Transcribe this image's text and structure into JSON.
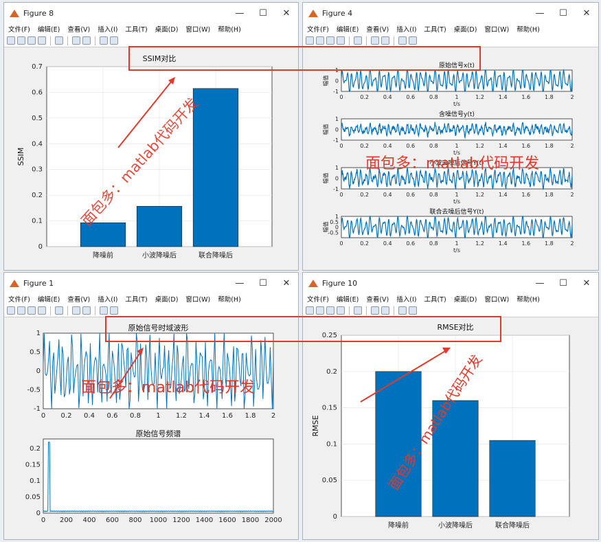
{
  "menu": [
    "文件(F)",
    "编辑(E)",
    "查看(V)",
    "插入(I)",
    "工具(T)",
    "桌面(D)",
    "窗口(W)",
    "帮助(H)"
  ],
  "watermark": "面包多：matlab代码开发",
  "fig8": {
    "title": "Figure 8",
    "chart_data": {
      "type": "bar",
      "title": "SSIM对比",
      "ylabel": "SSIM",
      "categories": [
        "降噪前",
        "小波降噪后",
        "联合降噪后"
      ],
      "values": [
        0.093,
        0.157,
        0.615
      ],
      "ylim": [
        0,
        0.7
      ],
      "yticks": [
        "0",
        "0.1",
        "0.2",
        "0.3",
        "0.4",
        "0.5",
        "0.6",
        "0.7"
      ],
      "color": "#0072bd"
    }
  },
  "fig4": {
    "title": "Figure 4",
    "chart_data": [
      {
        "type": "line",
        "title": "原始信号x(t)",
        "xlabel": "t/s",
        "ylabel": "幅值",
        "xlim": [
          0,
          2
        ],
        "ylim": [
          -1,
          1
        ],
        "yticks": [
          "1",
          "0",
          "-1"
        ],
        "xticks": [
          "0",
          "0.2",
          "0.4",
          "0.6",
          "0.8",
          "1",
          "1.2",
          "1.4",
          "1.6",
          "1.8",
          "2"
        ]
      },
      {
        "type": "line",
        "title": "含噪信号y(t)",
        "xlabel": "t/s",
        "ylabel": "幅值",
        "xlim": [
          0,
          2
        ],
        "ylim": [
          -1,
          1
        ],
        "yticks": [
          "1",
          "0",
          "-1"
        ],
        "xticks": [
          "0",
          "0.2",
          "0.4",
          "0.6",
          "0.8",
          "1",
          "1.2",
          "1.4",
          "1.6",
          "1.8",
          "2"
        ]
      },
      {
        "type": "line",
        "title": "小波去噪后信号Y(t)",
        "xlabel": "t/s",
        "ylabel": "幅值",
        "xlim": [
          0,
          2
        ],
        "ylim": [
          -1,
          1
        ],
        "yticks": [
          "1",
          "0",
          "-1"
        ],
        "xticks": [
          "0",
          "0.2",
          "0.4",
          "0.6",
          "0.8",
          "1",
          "1.2",
          "1.4",
          "1.6",
          "1.8",
          "2"
        ]
      },
      {
        "type": "line",
        "title": "联合去噪后信号Y(t)",
        "xlabel": "t/s",
        "ylabel": "幅值",
        "xlim": [
          0,
          2
        ],
        "ylim": [
          -1,
          1
        ],
        "yticks": [
          "1",
          "0.5",
          "0",
          "-0.5"
        ],
        "xticks": [
          "0",
          "0.2",
          "0.4",
          "0.6",
          "0.8",
          "1",
          "1.2",
          "1.4",
          "1.6",
          "1.8",
          "2"
        ]
      }
    ]
  },
  "fig1": {
    "title": "Figure 1",
    "chart_data": [
      {
        "type": "line",
        "title": "原始信号时域波形",
        "xlim": [
          0,
          2
        ],
        "ylim": [
          -1,
          1
        ],
        "yticks": [
          "1",
          "0.5",
          "0",
          "-0.5",
          "-1"
        ],
        "xticks": [
          "0",
          "0.2",
          "0.4",
          "0.6",
          "0.8",
          "1",
          "1.2",
          "1.4",
          "1.6",
          "1.8",
          "2"
        ]
      },
      {
        "type": "line",
        "title": "原始信号频谱",
        "xlim": [
          0,
          2000
        ],
        "ylim": [
          0,
          0.23
        ],
        "yticks": [
          "0.2",
          "0.15",
          "0.1",
          "0.05",
          "0"
        ],
        "xticks": [
          "0",
          "200",
          "400",
          "600",
          "800",
          "1000",
          "1200",
          "1400",
          "1600",
          "1800",
          "2000"
        ],
        "peak": {
          "x": [
            45,
            55
          ],
          "y": 0.22
        }
      }
    ]
  },
  "fig10": {
    "title": "Figure 10",
    "chart_data": {
      "type": "bar",
      "title": "RMSE对比",
      "ylabel": "RMSE",
      "categories": [
        "降噪前",
        "小波降噪后",
        "联合降噪后"
      ],
      "values": [
        0.2,
        0.16,
        0.105
      ],
      "ylim": [
        0,
        0.25
      ],
      "yticks": [
        "0",
        "0.05",
        "0.1",
        "0.15",
        "0.2",
        "0.25"
      ],
      "color": "#0072bd"
    }
  }
}
